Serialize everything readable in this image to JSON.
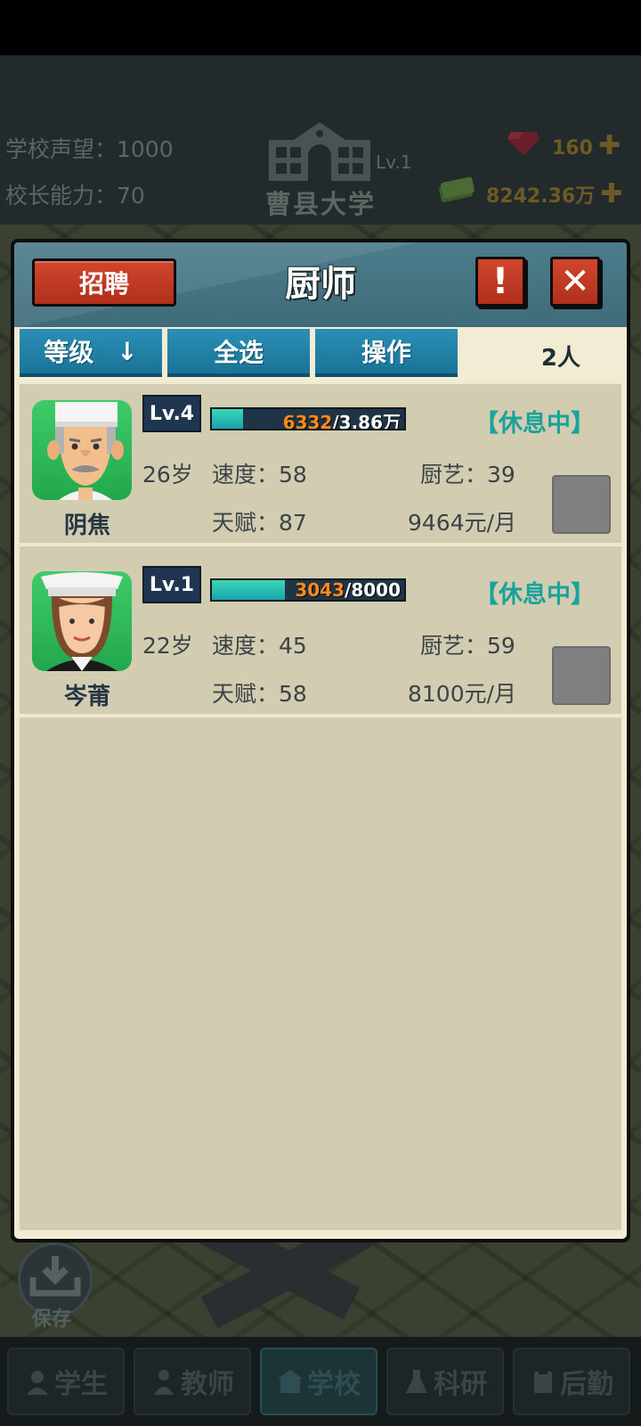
{
  "top": {
    "reputation_label": "学校声望：1000",
    "ability_label": "校长能力：70",
    "school_level": "Lv.1",
    "school_name": "曹县大学",
    "gems": "160",
    "money": "8242.36万"
  },
  "save_label": "保存",
  "nav": [
    {
      "label": "学生",
      "icon": "student-icon"
    },
    {
      "label": "教师",
      "icon": "teacher-icon"
    },
    {
      "label": "学校",
      "icon": "school-icon"
    },
    {
      "label": "科研",
      "icon": "research-icon"
    },
    {
      "label": "后勤",
      "icon": "logistics-icon"
    }
  ],
  "dialog": {
    "title": "厨师",
    "recruit_label": "招聘",
    "alert_label": "!",
    "close_label": "✕",
    "tabs": {
      "sort_label": "等级",
      "sort_arrow": "↓",
      "select_all_label": "全选",
      "operate_label": "操作"
    },
    "count_label": "2人"
  },
  "staff": [
    {
      "name": "阴焦",
      "level": "Lv.4",
      "xp_current": "6332",
      "xp_total": "/3.86万",
      "xp_fraction": 0.164,
      "status": "【休息中】",
      "age": "26岁",
      "speed": "速度：58",
      "skill": "厨艺：39",
      "talent": "天赋：87",
      "salary": "9464元/月",
      "avatar": "male-chef"
    },
    {
      "name": "岑莆",
      "level": "Lv.1",
      "xp_current": "3043",
      "xp_total": "/8000",
      "xp_fraction": 0.38,
      "status": "【休息中】",
      "age": "22岁",
      "speed": "速度：45",
      "skill": "厨艺：59",
      "talent": "天赋：58",
      "salary": "8100元/月",
      "avatar": "female-chef"
    }
  ],
  "colors": {
    "accent_red": "#c23c24",
    "tab_blue": "#1f82a8",
    "status_teal": "#1aa29c",
    "xp_orange": "#ff8a1c"
  }
}
